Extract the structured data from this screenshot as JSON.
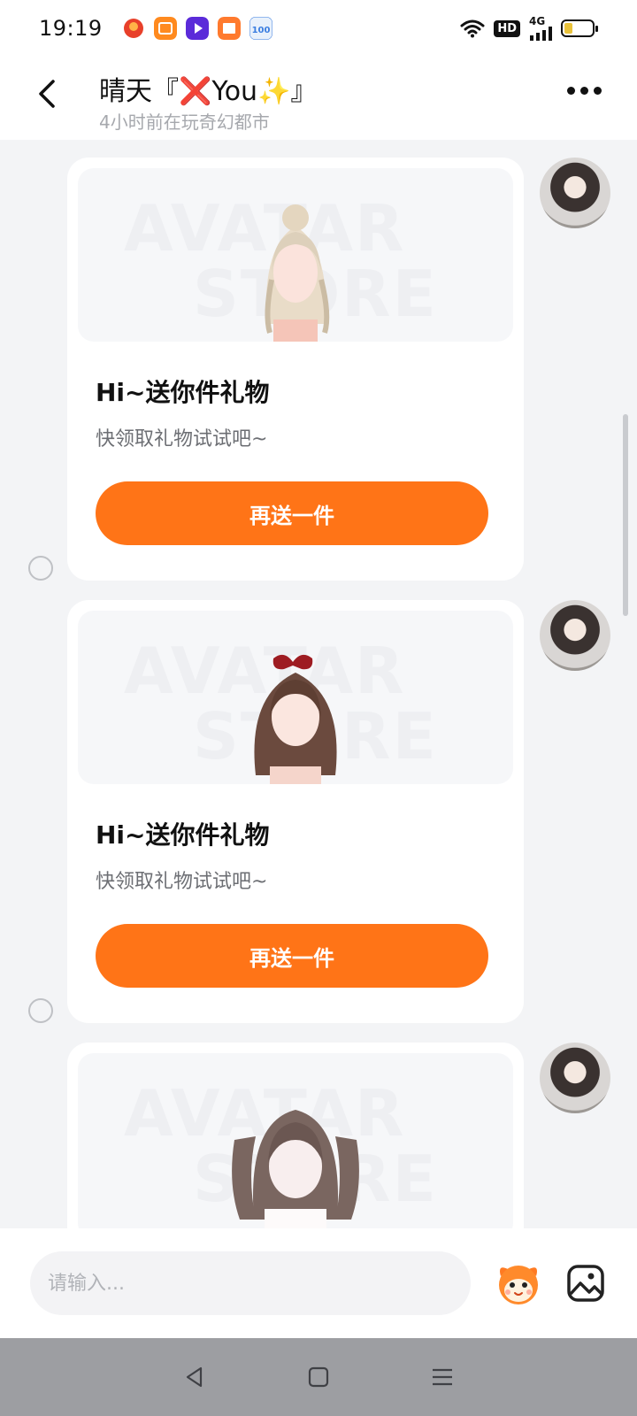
{
  "status_bar": {
    "time": "19:19",
    "hd": "HD",
    "network": "4G",
    "battery_level": 0.3
  },
  "header": {
    "title": "晴天『❌You✨』",
    "subtitle": "4小时前在玩奇幻都市"
  },
  "messages": [
    {
      "title": "Hi~送你件礼物",
      "desc": "快领取礼物试试吧~",
      "button": "再送一件",
      "gift": "blonde-updo-hair"
    },
    {
      "title": "Hi~送你件礼物",
      "desc": "快领取礼物试试吧~",
      "button": "再送一件",
      "gift": "brown-curly-hair-with-red-bow"
    },
    {
      "gift": "brown-twin-tails-hair"
    }
  ],
  "watermark": [
    "AVATAR",
    "STORE"
  ],
  "input": {
    "placeholder": "请输入..."
  },
  "colors": {
    "accent": "#ff7417",
    "background": "#f3f4f6"
  },
  "icons": [
    "back-arrow-icon",
    "more-icon",
    "emoji-mascot-icon",
    "image-icon",
    "nav-back-icon",
    "nav-home-icon",
    "nav-menu-icon"
  ]
}
